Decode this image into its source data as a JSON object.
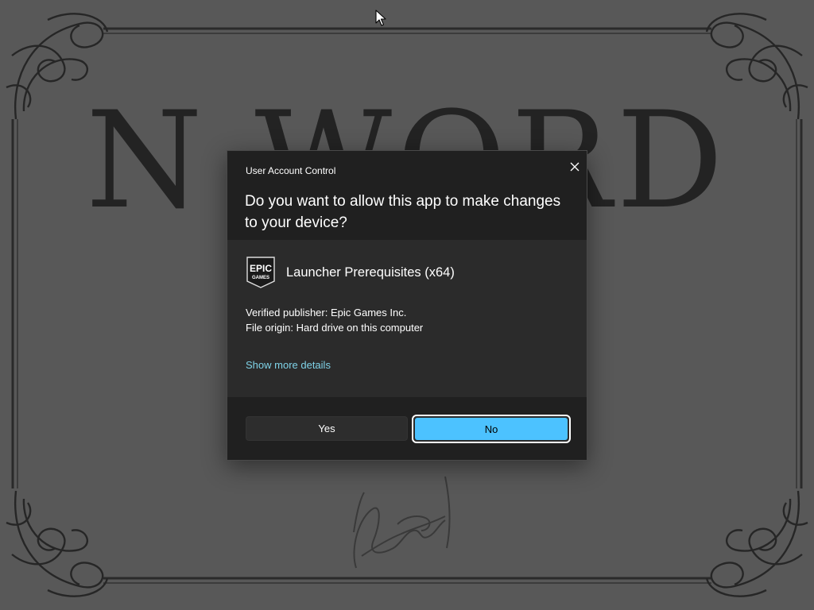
{
  "wallpaper": {
    "title": "N WORD",
    "corner_text_line1": "",
    "corner_text_line2": ""
  },
  "dialog": {
    "caption": "User Account Control",
    "question": "Do you want to allow this app to make changes to your device?",
    "app_name": "Launcher Prerequisites (x64)",
    "app_icon": "epic-games-icon",
    "verified_publisher": "Verified publisher: Epic Games Inc.",
    "file_origin": "File origin: Hard drive on this computer",
    "details_link": "Show more details",
    "yes_label": "Yes",
    "no_label": "No",
    "close_icon": "close-icon",
    "accent_color": "#4cc2ff",
    "link_color": "#7fd3e8"
  },
  "logo": {
    "line1": "EPIC",
    "line2": "GAMES"
  },
  "cursor": {
    "icon": "arrow-cursor-icon"
  }
}
